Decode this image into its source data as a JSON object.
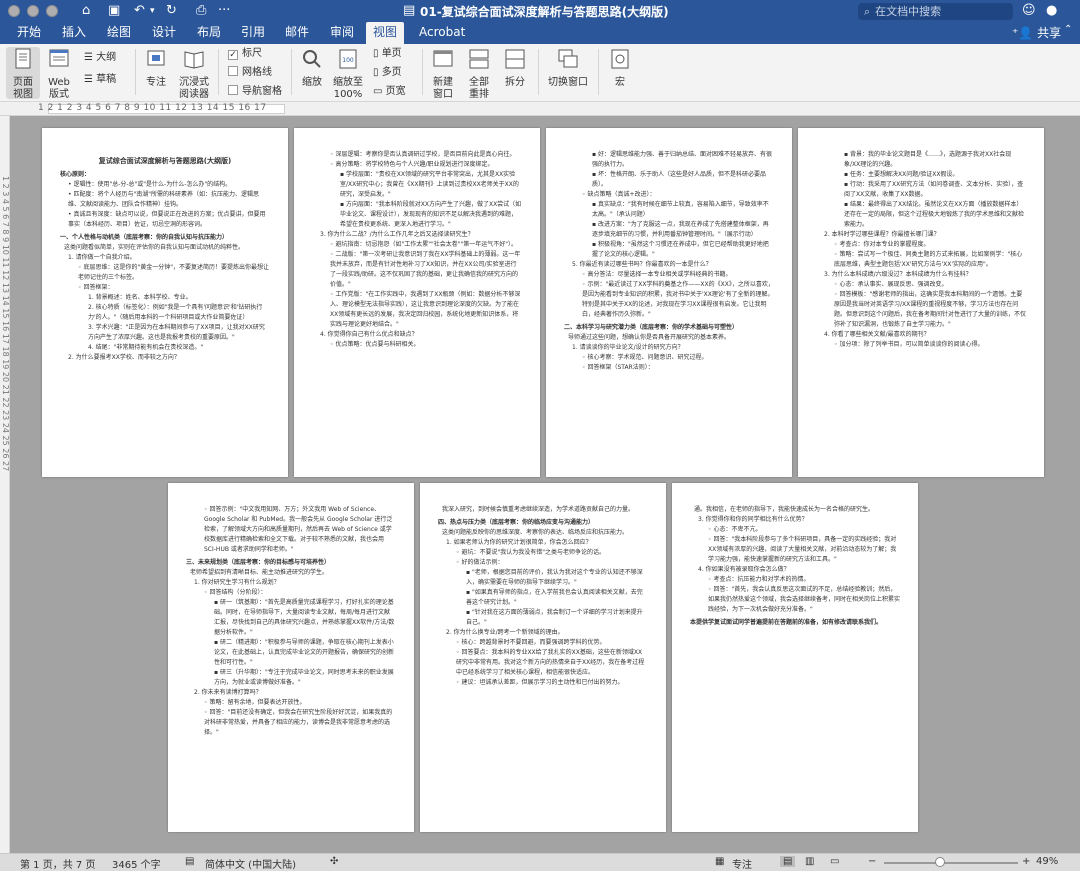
{
  "window": {
    "title": "01-复试综合面试深度解析与答题思路(大纲版)",
    "search_placeholder": "在文档中搜索",
    "share_label": "共享"
  },
  "tabs": [
    "开始",
    "插入",
    "绘图",
    "设计",
    "布局",
    "引用",
    "邮件",
    "审阅",
    "视图",
    "Acrobat"
  ],
  "active_tab": "视图",
  "ribbon": {
    "page_view": "页面\n视图",
    "web_view": "Web\n版式",
    "outline": "大纲",
    "draft": "草稿",
    "focus": "专注",
    "immersive": "沉浸式\n阅读器",
    "ruler": "标尺",
    "gridlines": "网格线",
    "nav_pane": "导航窗格",
    "zoom": "缩放",
    "zoom_100": "缩放至\n100%",
    "one_page": "单页",
    "multi_page": "多页",
    "page_width": "页宽",
    "new_window": "新建\n窗口",
    "arrange_all": "全部\n重排",
    "split": "拆分",
    "switch_window": "切换窗口",
    "macros": "宏"
  },
  "ruler_numbers": "1 2 1 2 3 4 5 6 7 8 9 10 11 12 13 14 15 16 17",
  "vruler_numbers": "1 2 3 4 5 6 7 8 9 10 11 12 13 14 15 16 17 18 19 20 21 22 23 24 25 26 27",
  "pages": [
    {
      "lines": [
        {
          "c": "ttl",
          "t": "复试综合面试深度解析与答题思路(大纲版)"
        },
        {
          "c": "h",
          "t": "核心原则："
        },
        {
          "c": "b",
          "t": "• 逻辑性：使用\"总-分-总\"或\"是什么-为什么-怎么办\"的结构。"
        },
        {
          "c": "b",
          "t": "• 匹配度：将个人经历与\"南湖\"所需的科研素养（如：抗压能力、逻辑思维、文献阅读能力、团队合作精神）挂钩。"
        },
        {
          "c": "b",
          "t": "• 真诚且有深度：缺点可以说，但要说正在改进的方案；优点要讲，但要用事实（本科经历、项目）佐证，切忌空洞的形容词。"
        },
        {
          "c": "h",
          "t": "一、个人性格与动机类（底层考察：你的自我认知与抗压能力）"
        },
        {
          "c": "t",
          "t": "这类问题看似简单，实则在评估你的自我认知与面试动机的纯粹性。"
        },
        {
          "c": "b",
          "t": "1. 请你做一个自我介绍。"
        },
        {
          "c": "b2",
          "t": "◦ 底层思维：这是你的\"黄金一分钟\"，不要复述简历！要提炼出你最想让老师记住的三个标签。"
        },
        {
          "c": "b2",
          "t": "◦ 回答框架："
        },
        {
          "c": "b3",
          "t": "1. 背景概述：姓名、本科学校、专业。"
        },
        {
          "c": "b3",
          "t": "2. 核心特质（标签化）：例如\"我是一个具有'问题意识'和'钻研执行力'的人。\"（随后用本科的一个科研项目或大作业简要佐证）"
        },
        {
          "c": "b3",
          "t": "3. 学术兴趣：\"正是因为在本科期间参与了XX项目，让我对XX研究方向产生了浓厚兴趣。这也是我报考贵校的重要原因。\""
        },
        {
          "c": "b3",
          "t": "4. 结尾：\"非常期待能有机会在贵校深造。\""
        },
        {
          "c": "b",
          "t": "2. 为什么要报考XX学校、而非较之方向？"
        }
      ]
    },
    {
      "lines": [
        {
          "c": "b2",
          "t": "◦ 深层逻辑：考察你是否认真调研过学校，是否目前向此是真心向往。"
        },
        {
          "c": "b2",
          "t": "◦ 高分策略：将学校特色与个人兴趣/职业规划进行深度绑定。"
        },
        {
          "c": "b3",
          "t": "▪ 学校层面：\"贵校在XX领域的研究平台非常突出，尤其是XX实验室/XX研究中心；我曾在《XX期刊》上读到过贵校XX老师关于XX的研究，深受启发。\""
        },
        {
          "c": "b3",
          "t": "▪ 方向层面：\"我本科阶段就对XX方向产生了兴趣，做了XX尝试（如毕业论文、课程设计），发现现有的知识不足以解决我遇到的难题，希望在贵校更系统、更深入地进行学习。\""
        },
        {
          "c": "b",
          "t": "3. 你为什么二战？/为什么工作几年之后又选择读研究生？"
        },
        {
          "c": "b2",
          "t": "◦ 避坑指南：切忌抱怨（如\"工作太累\"\"社会太卷\"\"第一年运气不好\"）。"
        },
        {
          "c": "b2",
          "t": "◦ 二战版：\"第一次考研让我意识到了我在XX学科基础上的薄弱。这一年我并未放弃，而是有针对性地补习了XX知识，并在XX公司/实验室进行了一段实践/助研。这不仅巩固了我的基础，更让我确信我的研究方向的价值。\""
        },
        {
          "c": "b2",
          "t": "◦ 工作党版：\"在工作实践中，我遇到了XX瓶颈（例如：数据分析不够深入、理论模型无法指导实践），这让我意识到理论深度的欠缺。为了能在XX领域有更长远的发展，我决定回归校园，系统化地更新知识体系，将实践与理论更好地结合。\""
        },
        {
          "c": "b",
          "t": "4. 你觉得你自己有什么优点和缺点？"
        },
        {
          "c": "b2",
          "t": "◦ 优点策略：优点要与科研相关。"
        }
      ]
    },
    {
      "lines": [
        {
          "c": "b3",
          "t": "▪ 好：逻辑思维能力强、善于归纳总结、面对困难不轻易放弃、有很强的执行力。"
        },
        {
          "c": "b3",
          "t": "▪ 坏：性格开朗、乐于助人（这些是好人品质，但不是科研必要品质）。"
        },
        {
          "c": "b2",
          "t": "◦ 缺点策略（真诚+改进）："
        },
        {
          "c": "b3",
          "t": "▪ 真实缺点：\"我有时候在细节上较真，容易陷入细节，导致效率不太高。\"（承认问题）"
        },
        {
          "c": "b3",
          "t": "▪ 改进方案：\"为了克服这一点，我现在养成了先搭建整体框架，再逐步填充细节的习惯，并利用番茄钟管理时间。\"（展示行动）"
        },
        {
          "c": "b3",
          "t": "▪ 积极视角：\"虽然这个习惯还在养成中，但它已经帮助我更好地把握了论文的核心逻辑。\""
        },
        {
          "c": "b",
          "t": "5. 你最近有读过哪些书吗？你最喜欢的一本是什么？"
        },
        {
          "c": "b2",
          "t": "◦ 高分答法：尽量选择一本专业相关或学科经典的书籍。"
        },
        {
          "c": "b2",
          "t": "◦ 示例：\"最近读过了XX学科的奠基之作——XX的《XX》，之所以喜欢，是因为能看到专业知识的积累，我对书中关于'XX理论'有了全新的理解。特别是其中关于XX的论述，对我现在学习XX课程很有启发。它让我明白，经典著作历久弥新。\""
        },
        {
          "c": "h",
          "t": "二、本科学习与研究潜力类（底层考察：你的学术基础与可塑性）"
        },
        {
          "c": "t",
          "t": "导师通过这些问题，想确认你是否具备开展研究的基本素养。"
        },
        {
          "c": "b",
          "t": "1. 请谈谈你的毕业论文/设计的研究方向？"
        },
        {
          "c": "b2",
          "t": "◦ 核心考察：学术规范、问题意识、研究过程。"
        },
        {
          "c": "b2",
          "t": "◦ 回答框架（STAR法则）："
        }
      ]
    },
    {
      "lines": [
        {
          "c": "b3",
          "t": "▪ 背景：我的毕业论文题目是《……》，选题源于我对XX社会现象/XX理论的兴趣。"
        },
        {
          "c": "b3",
          "t": "▪ 任务：主要想解决XX问题/验证XX假设。"
        },
        {
          "c": "b3",
          "t": "▪ 行动：我采用了XX研究方法（如问卷调查、文本分析、实验），查阅了XX文献，收集了XX数据。"
        },
        {
          "c": "b3",
          "t": "▪ 结果：最终得出了XX结论。虽然论文在XX方面（播放数据样本）还存在一定的局限，但这个过程极大地锻炼了我的学术思维和文献检索能力。"
        },
        {
          "c": "b",
          "t": "2. 本科时学过哪些课程？你最擅长哪门课？"
        },
        {
          "c": "b2",
          "t": "◦ 考查点：你对本专业的掌握程度。"
        },
        {
          "c": "b2",
          "t": "◦ 策略：尝试写一个极佳、同类主题的方式来拓展，比如案例学：\"核心底层思维，典型主题包括'XX'研究方法与'XX'实际的应用\"。"
        },
        {
          "c": "b",
          "t": "3. 为什么本科成绩/六级没过？本科成绩为什么有挂科？"
        },
        {
          "c": "b2",
          "t": "◦ 心态：承认事实、展现反思、强调改变。"
        },
        {
          "c": "b2",
          "t": "◦ 回答模板：\"感谢老师的指出，这确实是我本科期间的一个遗憾。主要原因是我当时对英语学习/XX课程的重视程度不够，学习方法也存在问题。但意识到这个问题后，我在备考期间针对性进行了大量的训练，不仅弥补了知识漏洞，也锻炼了自主学习能力。\""
        },
        {
          "c": "b",
          "t": "4. 你看了哪些相关文献/最喜欢的期刊？"
        },
        {
          "c": "b2",
          "t": "◦ 加分项：除了列举书目，可以简单谈谈你的阅读心得。"
        }
      ]
    },
    {
      "lines": [
        {
          "c": "b2",
          "t": "◦ 回答示例：\"中文我用知网、万方；外文我用 Web of Science、Google Scholar 和 PubMed。我一般会先从 Google Scholar 进行泛检索，了解领域大方向和高质量期刊，然后再去 Web of Science 或学校数据库进行精确检索和全文下载。对于较不熟悉的文献，我也会用 SCI-HUB 或者求助同学和老师。\""
        },
        {
          "c": "h",
          "t": "三、未来规划类（底层考察：你的目标感与可培养性）"
        },
        {
          "c": "t",
          "t": "老师希望招到有清晰目标、能主动推进研究的学生。"
        },
        {
          "c": "b",
          "t": "1. 你对研究生学习有什么规划？"
        },
        {
          "c": "b2",
          "t": "◦ 回答结构（分阶段）："
        },
        {
          "c": "b3",
          "t": "▪ 研一（筑基期）：\"首先是高质量完成课程学习，打好扎实的理论基础。同时，在导师指导下，大量阅读专业文献，每周/每月进行文献汇报，尽快找到自己的具体研究兴趣点，并熟练掌握XX软件/方法/数据分析软件。\""
        },
        {
          "c": "b3",
          "t": "▪ 研二（精进期）：\"积极参与导师的课题，争取在核心期刊上发表小论文，在此基础上，认真完成毕业论文的开题报告，确保研究的创新性和可行性。\""
        },
        {
          "c": "b3",
          "t": "▪ 研三（升华期）：\"专注于完成毕业论文，同时思考未来的职业发展方向，为就业或读博做好准备。\""
        },
        {
          "c": "b",
          "t": "2. 你未来有读博打算吗？"
        },
        {
          "c": "b2",
          "t": "◦ 策略：留有余地，但要表达开放性。"
        },
        {
          "c": "b2",
          "t": "◦ 回答：\"目前还没有确定，但我会在研究生阶段好好沉淀，如果我真的对科研非常热爱，并具备了相应的能力，读博会是我非常愿意考虑的选择。\""
        }
      ]
    },
    {
      "lines": [
        {
          "c": "t",
          "t": "我深入研究，到时候会慎重考虑继续深造，为学术道路贡献自己的力量。"
        },
        {
          "c": "h",
          "t": "四、热点与压力类（底层考察：你的临场应变与沟通能力）"
        },
        {
          "c": "t",
          "t": "这类问题能反映你的思维深度、考察你的表达、临场反应和抗压能力。"
        },
        {
          "c": "b",
          "t": "1. 如果老师认为你的研究计划很简单，你会怎么回应？"
        },
        {
          "c": "b2",
          "t": "◦ 避坑：不要说\"我认为我没有错\"之类与老师争论的话。"
        },
        {
          "c": "b2",
          "t": "◦ 好的做法示例："
        },
        {
          "c": "b3",
          "t": "▪ \"老师，根据您目前的评价，我认为我对这个专业的认知还不够深入，确实需要在导师的指导下继续学习。\""
        },
        {
          "c": "b3",
          "t": "▪ \"如果真有导师的指点，在入学前我也会认真阅读相关文献，去完善这个研究计划。\""
        },
        {
          "c": "b3",
          "t": "▪ \"针对我在这方面的薄弱点，我会制订一个详细的学习计划来提升自己。\""
        },
        {
          "c": "b",
          "t": "2. 你为什么换专业/跨考一个新领域的理由。"
        },
        {
          "c": "b2",
          "t": "◦ 核心：跨越背景时不要回避，而要强调跨学科的优势。"
        },
        {
          "c": "b2",
          "t": "◦ 回答要点：我本科的专业XX给了我扎实的XX基础，这些在新领域XX研究中非常有用。我对这个新方向的热情来自于XX经历，我在备考过程中已经系统学习了相关核心课程，相信能很快适应。"
        },
        {
          "c": "b2",
          "t": "◦ 建议：坦诚承认差距，但展示学习的主动性和已付出的努力。"
        }
      ]
    },
    {
      "lines": [
        {
          "c": "t",
          "t": "通。我相信，在老师的指导下，我能快速成长为一名合格的研究生。"
        },
        {
          "c": "b",
          "t": "3. 你觉得你和你的同学相比有什么优势？"
        },
        {
          "c": "b2",
          "t": "◦ 心态：不卑不亢。"
        },
        {
          "c": "b2",
          "t": "◦ 回答：\"我本科阶段参与了多个科研项目，具备一定的实践经验；我对XX领域有浓厚的兴趣，阅读了大量相关文献，对前沿动态较为了解；我学习能力强，能快速掌握新的研究方法和工具。\""
        },
        {
          "c": "b",
          "t": "4. 你如果没有被录取你会怎么做？"
        },
        {
          "c": "b2",
          "t": "◦ 考查点：抗压能力和对学术的热情。"
        },
        {
          "c": "b2",
          "t": "◦ 回答：\"首先，我会认真反思这次面试的不足，总结经验教训；然后，如果我仍然热爱这个领域，我会选择继续备考，同时在相关岗位上积累实践经验，为下一次机会做好充分准备。\""
        },
        {
          "c": "h",
          "t": "本提供学复试面试同学普遍提前在答题前的准备，如有修改请联系我们。"
        }
      ]
    }
  ],
  "status": {
    "page": "第 1 页，共 7 页",
    "words": "3465 个字",
    "language": "简体中文 (中国大陆)",
    "focus": "专注",
    "zoom": "49%"
  }
}
